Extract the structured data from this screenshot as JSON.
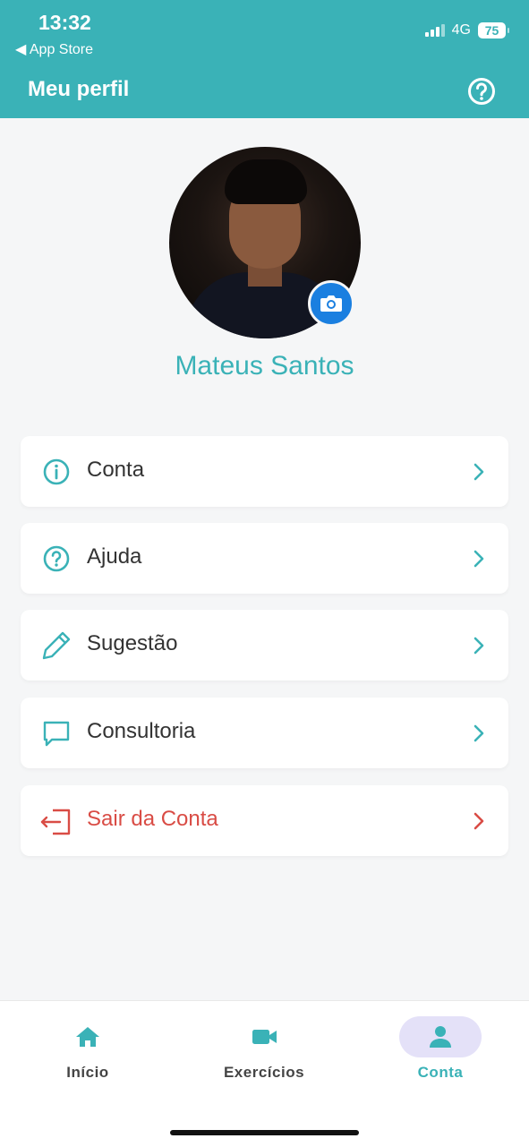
{
  "status_bar": {
    "time": "13:32",
    "back_label": "◀ App Store",
    "network": "4G",
    "battery": "75"
  },
  "header": {
    "title": "Meu perfil",
    "help_icon": "help-circle-icon"
  },
  "profile": {
    "name": "Mateus Santos",
    "camera_icon": "camera-icon"
  },
  "menu": [
    {
      "label": "Conta",
      "icon": "info-icon"
    },
    {
      "label": "Ajuda",
      "icon": "help-circle-icon"
    },
    {
      "label": "Sugestão",
      "icon": "pencil-icon"
    },
    {
      "label": "Consultoria",
      "icon": "chat-icon"
    },
    {
      "label": "Sair da Conta",
      "icon": "logout-icon"
    }
  ],
  "bottom_nav": [
    {
      "label": "Início",
      "icon": "home-icon"
    },
    {
      "label": "Exercícios",
      "icon": "video-camera-icon"
    },
    {
      "label": "Conta",
      "icon": "user-icon",
      "active": true
    }
  ],
  "colors": {
    "brand": "#3ab2b7",
    "danger": "#d94c45",
    "camera": "#1a7fe0",
    "nav_active_bg": "#e4e1f8"
  }
}
